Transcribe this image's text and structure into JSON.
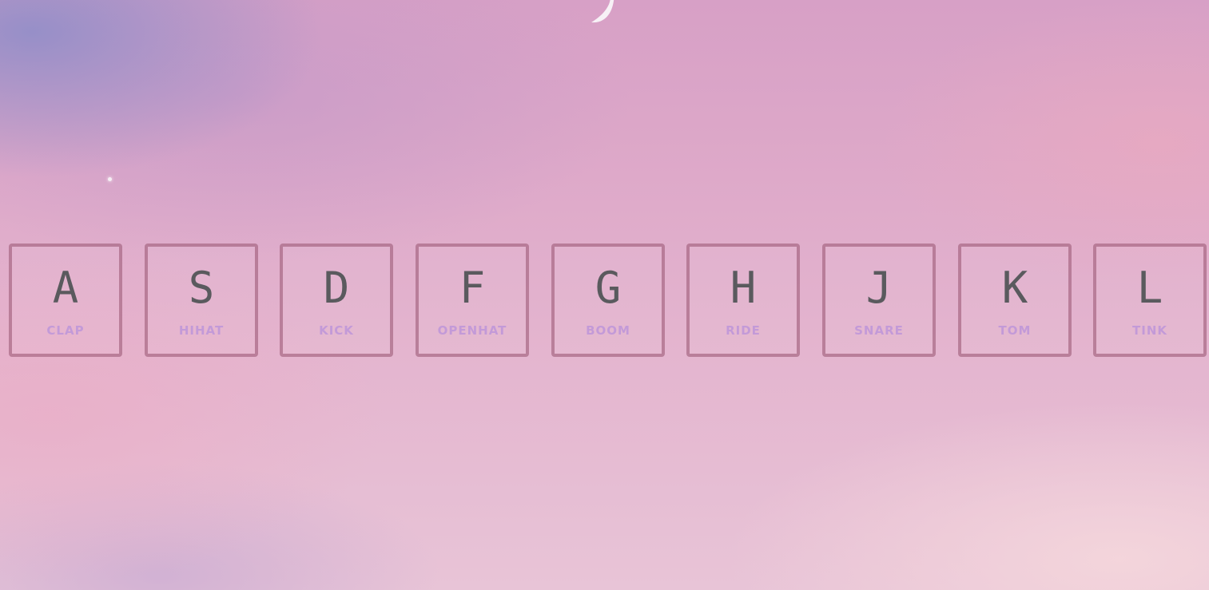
{
  "colors": {
    "key_border": "#a0607c",
    "letter": "#5a5a5e",
    "sound_label": "#c39ad8"
  },
  "decorations": {
    "moon": "crescent-moon-icon",
    "star": "star-icon"
  },
  "keys": [
    {
      "letter": "A",
      "sound": "CLAP"
    },
    {
      "letter": "S",
      "sound": "HIHAT"
    },
    {
      "letter": "D",
      "sound": "KICK"
    },
    {
      "letter": "F",
      "sound": "OPENHAT"
    },
    {
      "letter": "G",
      "sound": "BOOM"
    },
    {
      "letter": "H",
      "sound": "RIDE"
    },
    {
      "letter": "J",
      "sound": "SNARE"
    },
    {
      "letter": "K",
      "sound": "TOM"
    },
    {
      "letter": "L",
      "sound": "TINK"
    }
  ]
}
